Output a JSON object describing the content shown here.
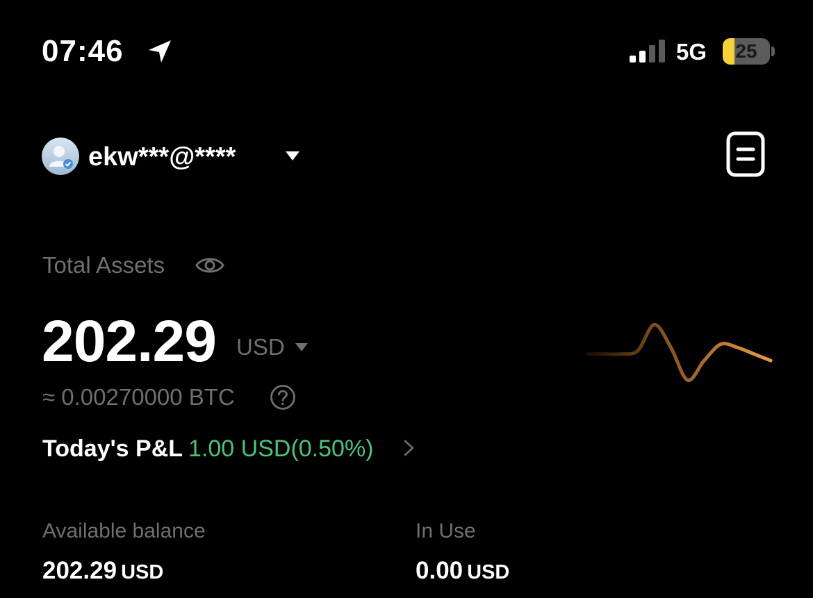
{
  "status_bar": {
    "time": "07:46",
    "network": "5G",
    "battery_percent": 25,
    "battery_label": "25",
    "signal_bars_active": 2,
    "signal_bars_total": 4
  },
  "account": {
    "name": "ekw***@****",
    "avatar_icon": "user-avatar-icon",
    "dropdown_icon": "caret-down-icon",
    "records_icon": "document-icon"
  },
  "assets": {
    "label": "Total Assets",
    "visibility_icon": "eye-icon",
    "total_value": "202.29",
    "currency": "USD",
    "btc_equivalent": "≈ 0.00270000 BTC",
    "help_icon": "question-circle-icon",
    "pnl_label": "Today's P&L",
    "pnl_value": "1.00 USD(0.50%)",
    "pnl_chevron_icon": "chevron-right-icon"
  },
  "sparkline": {
    "color_start": "#1a0e04",
    "color_end": "#e89a46",
    "values": [
      0.45,
      0.45,
      0.45,
      0.5,
      0.9,
      0.55,
      0.05,
      0.35,
      0.6,
      0.55,
      0.45,
      0.35
    ]
  },
  "balances": {
    "available_label": "Available balance",
    "available_value": "202.29",
    "available_currency": "USD",
    "in_use_label": "In Use",
    "in_use_value": "0.00",
    "in_use_currency": "USD"
  },
  "colors": {
    "background": "#000000",
    "muted_text": "#6f6f6f",
    "positive": "#4fc27a",
    "battery_yellow": "#f5d23a"
  }
}
